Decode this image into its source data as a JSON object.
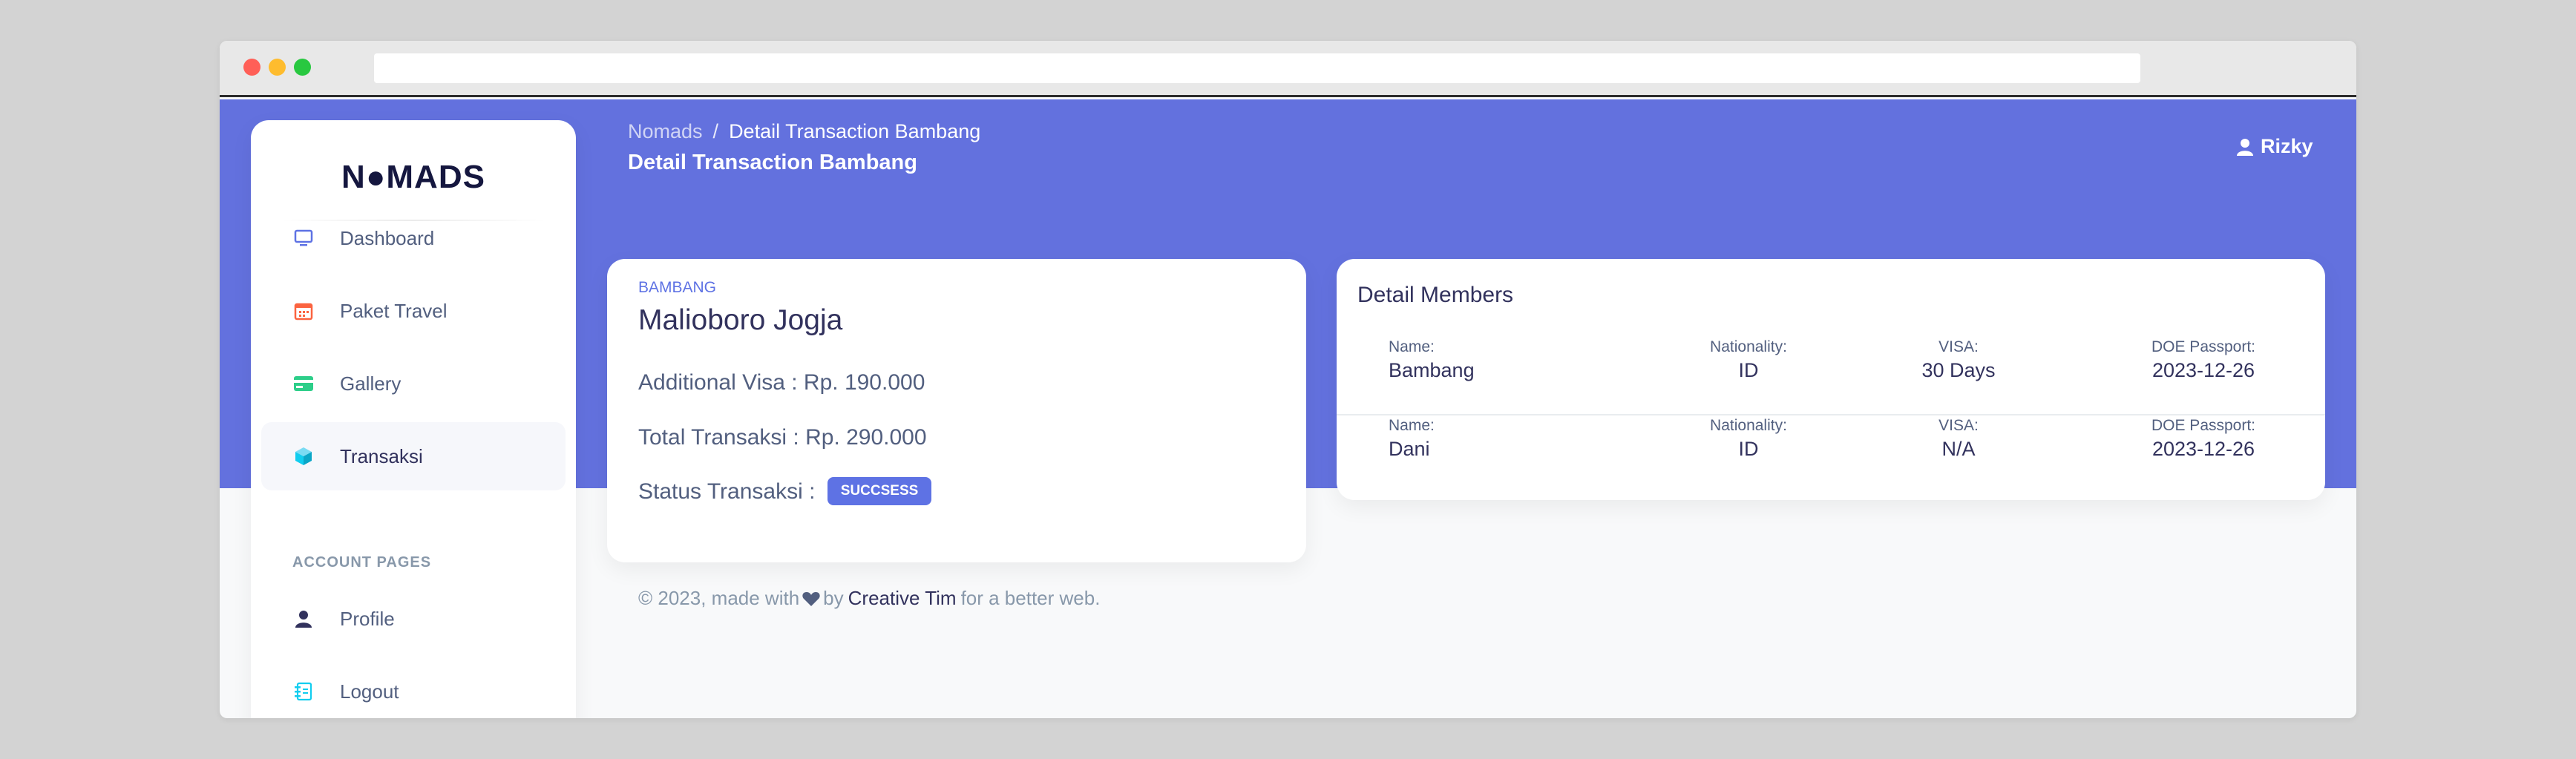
{
  "brand": {
    "logo_text": "N●MADS"
  },
  "sidebar": {
    "items": [
      {
        "label": "Dashboard",
        "icon": "monitor-icon",
        "color": "#5e72e4"
      },
      {
        "label": "Paket Travel",
        "icon": "calendar-icon",
        "color": "#fb6340"
      },
      {
        "label": "Gallery",
        "icon": "credit-card-icon",
        "color": "#2dce89"
      },
      {
        "label": "Transaksi",
        "icon": "box-icon",
        "color": "#11cdef",
        "active": true
      }
    ],
    "section_heading": "ACCOUNT PAGES",
    "account_items": [
      {
        "label": "Profile",
        "icon": "user-icon",
        "color": "#32325d"
      },
      {
        "label": "Logout",
        "icon": "logout-icon",
        "color": "#11cdef"
      }
    ]
  },
  "header": {
    "breadcrumb": {
      "root": "Nomads",
      "separator": "/",
      "current": "Detail Transaction Bambang"
    },
    "title": "Detail Transaction Bambang",
    "user_name": "Rizky"
  },
  "transaction": {
    "eyebrow": "BAMBANG",
    "title": "Malioboro Jogja",
    "additional_visa": "Additional Visa : Rp. 190.000",
    "total": "Total Transaksi : Rp. 290.000",
    "status_label": "Status Transaksi :",
    "status_badge": "SUCCSESS"
  },
  "members": {
    "title": "Detail Members",
    "labels": {
      "name": "Name:",
      "nationality": "Nationality:",
      "visa": "VISA:",
      "doe": "DOE Passport:"
    },
    "rows": [
      {
        "name": "Bambang",
        "nationality": "ID",
        "visa": "30 Days",
        "doe": "2023-12-26"
      },
      {
        "name": "Dani",
        "nationality": "ID",
        "visa": "N/A",
        "doe": "2023-12-26"
      }
    ]
  },
  "footer": {
    "prefix": "© 2023, made with",
    "by": "by",
    "author": "Creative Tim",
    "suffix": "for a better web."
  },
  "colors": {
    "hero": "#6371de",
    "accent": "#5e72e4"
  }
}
